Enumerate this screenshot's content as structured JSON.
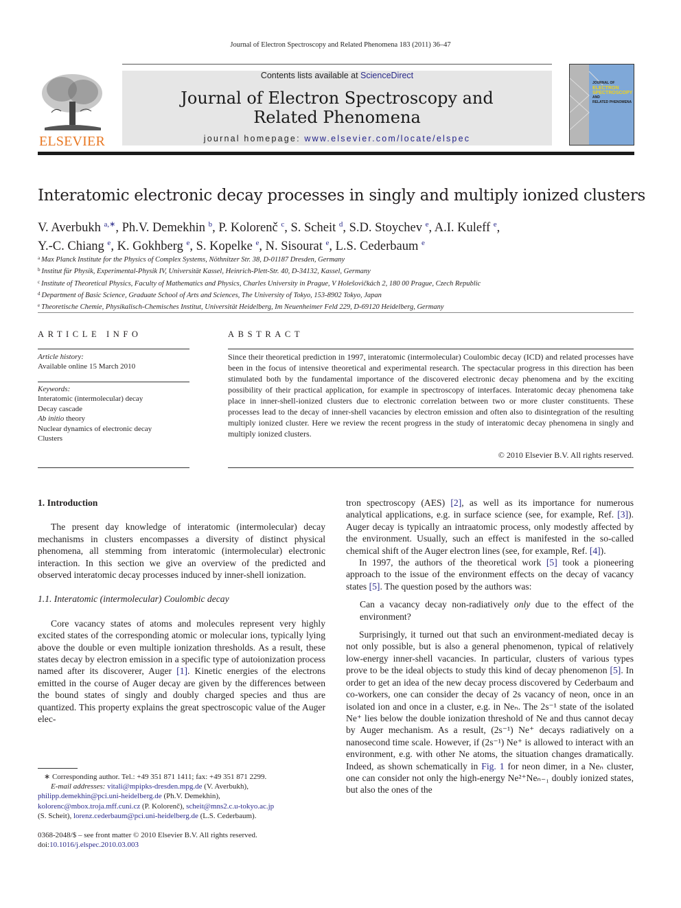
{
  "running_head": "Journal of Electron Spectroscopy and Related Phenomena 183 (2011) 36–47",
  "header": {
    "publisher": "ELSEVIER",
    "contents_prefix": "Contents lists available at ",
    "contents_link": "ScienceDirect",
    "journal_title_line1": "Journal of Electron Spectroscopy and",
    "journal_title_line2": "Related Phenomena",
    "homepage_prefix": "journal homepage: ",
    "homepage_link": "www.elsevier.com/locate/elspec",
    "cover_lines": [
      "JOURNAL OF",
      "ELECTRON",
      "SPECTROSCOPY",
      "AND",
      "RELATED PHENOMENA"
    ],
    "colors": {
      "publisher_orange": "#e87722",
      "link_blue": "#23238a",
      "cover_blue": "#7fa8d8",
      "header_grey": "#e6e6e6"
    }
  },
  "article": {
    "title": "Interatomic electronic decay processes in singly and multiply ionized clusters",
    "authors": [
      {
        "name": "V. Averbukh",
        "aff": "a,∗"
      },
      {
        "name": "Ph.V. Demekhin",
        "aff": "b"
      },
      {
        "name": "P. Kolorenč",
        "aff": "c"
      },
      {
        "name": "S. Scheit",
        "aff": "d"
      },
      {
        "name": "S.D. Stoychev",
        "aff": "e"
      },
      {
        "name": "A.I. Kuleff",
        "aff": "e"
      },
      {
        "name": "Y.-C. Chiang",
        "aff": "e"
      },
      {
        "name": "K. Gokhberg",
        "aff": "e"
      },
      {
        "name": "S. Kopelke",
        "aff": "e"
      },
      {
        "name": "N. Sisourat",
        "aff": "e"
      },
      {
        "name": "L.S. Cederbaum",
        "aff": "e"
      }
    ],
    "affiliations": [
      {
        "key": "a",
        "text": "Max Planck Institute for the Physics of Complex Systems, Nöthnitzer Str. 38, D-01187 Dresden, Germany"
      },
      {
        "key": "b",
        "text": "Institut für Physik, Experimental-Physik IV, Universität Kassel, Heinrich-Plett-Str. 40, D-34132, Kassel, Germany"
      },
      {
        "key": "c",
        "text": "Institute of Theoretical Physics, Faculty of Mathematics and Physics, Charles University in Prague, V Holešovičkách 2, 180 00 Prague, Czech Republic"
      },
      {
        "key": "d",
        "text": "Department of Basic Science, Graduate School of Arts and Sciences, The University of Tokyo, 153-8902 Tokyo, Japan"
      },
      {
        "key": "e",
        "text": "Theoretische Chemie, Physikalisch-Chemisches Institut, Universität Heidelberg, Im Neuenheimer Feld 229, D-69120 Heidelberg, Germany"
      }
    ]
  },
  "article_info": {
    "heading": "ARTICLE INFO",
    "history_label": "Article history:",
    "history_value": "Available online 15 March 2010",
    "keywords_label": "Keywords:",
    "keywords": [
      "Interatomic (intermolecular) decay",
      "Decay cascade",
      "Ab initio theory",
      "Nuclear dynamics of electronic decay",
      "Clusters"
    ]
  },
  "abstract": {
    "heading": "ABSTRACT",
    "text": "Since their theoretical prediction in 1997, interatomic (intermolecular) Coulombic decay (ICD) and related processes have been in the focus of intensive theoretical and experimental research. The spectacular progress in this direction has been stimulated both by the fundamental importance of the discovered electronic decay phenomena and by the exciting possibility of their practical application, for example in spectroscopy of interfaces. Interatomic decay phenomena take place in inner-shell-ionized clusters due to electronic correlation between two or more cluster constituents. These processes lead to the decay of inner-shell vacancies by electron emission and often also to disintegration of the resulting multiply ionized cluster. Here we review the recent progress in the study of interatomic decay phenomena in singly and multiply ionized clusters.",
    "copyright": "© 2010 Elsevier B.V. All rights reserved."
  },
  "body": {
    "section1_heading": "1.  Introduction",
    "section1_p1": "The present day knowledge of interatomic (intermolecular) decay mechanisms in clusters encompasses a diversity of distinct physical phenomena, all stemming from interatomic (intermolecular) electronic interaction. In this section we give an overview of the predicted and observed interatomic decay processes induced by inner-shell ionization.",
    "section11_heading": "1.1.  Interatomic (intermolecular) Coulombic decay",
    "section11_p1_a": "Core vacancy states of atoms and molecules represent very highly excited states of the corresponding atomic or molecular ions, typically lying above the double or even multiple ionization thresholds. As a result, these states decay by electron emission in a specific type of autoionization process named after its discoverer, Auger ",
    "ref1": "[1]",
    "section11_p1_b": ". Kinetic energies of the electrons emitted in the course of Auger decay are given by the differences between the bound states of singly and doubly charged species and thus are quantized. This property explains the great spectroscopic value of the Auger elec-",
    "right_p1_a": "tron spectroscopy (AES) ",
    "ref2": "[2]",
    "right_p1_b": ", as well as its importance for numerous analytical applications, e.g. in surface science (see, for example, Ref. ",
    "ref3": "[3]",
    "right_p1_c": "). Auger decay is typically an intraatomic process, only modestly affected by the environment. Usually, such an effect is manifested in the so-called chemical shift of the Auger electron lines (see, for example, Ref. ",
    "ref4": "[4]",
    "right_p1_d": ").",
    "right_p2_a": "In 1997, the authors of the theoretical work ",
    "ref5": "[5]",
    "right_p2_b": " took a pioneering approach to the issue of the environment effects on the decay of vacancy states ",
    "right_p2_c": ". The question posed by the authors was:",
    "quote_a": "Can a vacancy decay non-radiatively ",
    "quote_only": "only",
    "quote_b": " due to the effect of the environment?",
    "right_p3_a": "Surprisingly, it turned out that such an environment-mediated decay is not only possible, but is also a general phenomenon, typical of relatively low-energy inner-shell vacancies. In particular, clusters of various types prove to be the ideal objects to study this kind of decay phenomenon ",
    "right_p3_b": ". In order to get an idea of the new decay process discovered by Cederbaum and co-workers, one can consider the decay of 2s vacancy of neon, once in an isolated ion and once in a cluster, e.g. in Neₙ. The 2s⁻¹ state of the isolated Ne⁺ lies below the double ionization threshold of Ne and thus cannot decay by Auger mechanism. As a result, (2s⁻¹) Ne⁺ decays radiatively on a nanosecond time scale. However, if (2s⁻¹) Ne⁺ is allowed to interact with an environment, e.g. with other Ne atoms, the situation changes dramatically. Indeed, as shown schematically in ",
    "fig1": "Fig. 1",
    "right_p3_c": " for neon dimer, in a Neₙ cluster, one can consider not only the high-energy Ne²⁺Neₙ₋₁ doubly ionized states, but also the ones of the"
  },
  "footnotes": {
    "corresponding": "∗ Corresponding author. Tel.: +49 351 871 1411; fax: +49 351 871 2299.",
    "email_label": "E-mail addresses: ",
    "emails": [
      {
        "addr": "vitali@mpipks-dresden.mpg.de",
        "who": " (V. Averbukh),"
      },
      {
        "addr": "philipp.demekhin@pci.uni-heidelberg.de",
        "who": " (Ph.V. Demekhin),"
      },
      {
        "addr": "kolorenc@mbox.troja.mff.cuni.cz",
        "who": " (P. Kolorenč), "
      },
      {
        "addr": "scheit@mns2.c.u-tokyo.ac.jp",
        "who": " (S. Scheit), "
      },
      {
        "addr": "lorenz.cederbaum@pci.uni-heidelberg.de",
        "who": " (L.S. Cederbaum)."
      }
    ],
    "front_matter": "0368-2048/$ – see front matter © 2010 Elsevier B.V. All rights reserved.",
    "doi_label": "doi:",
    "doi": "10.1016/j.elspec.2010.03.003"
  }
}
